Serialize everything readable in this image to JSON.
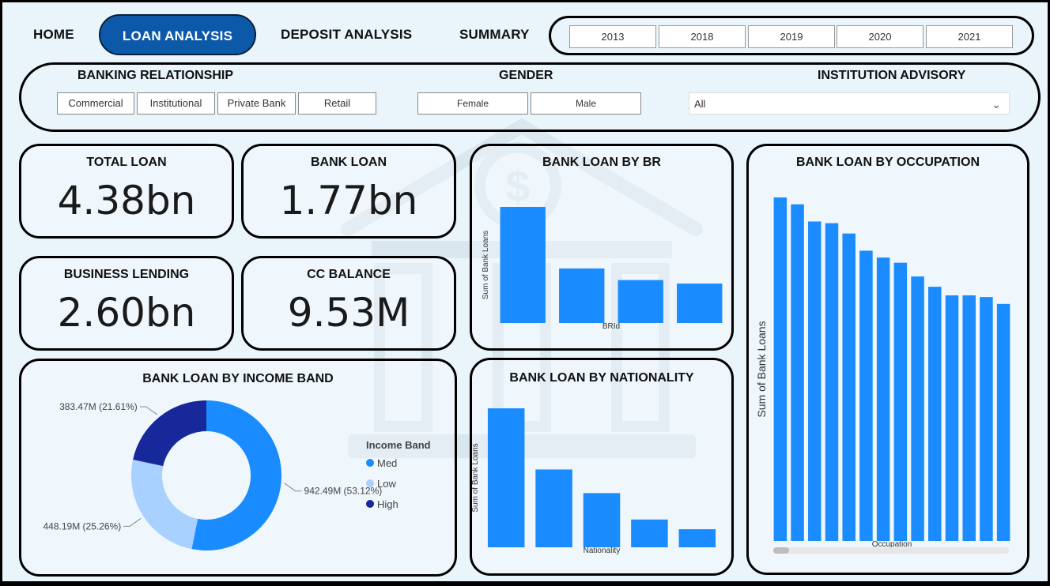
{
  "nav": {
    "home": "HOME",
    "loan_analysis": "LOAN ANALYSIS",
    "deposit_analysis": "DEPOSIT ANALYSIS",
    "summary": "SUMMARY"
  },
  "years": [
    "2013",
    "2018",
    "2019",
    "2020",
    "2021"
  ],
  "filters": {
    "banking_relationship": {
      "title": "BANKING RELATIONSHIP",
      "options": [
        "Commercial",
        "Institutional",
        "Private Bank",
        "Retail"
      ]
    },
    "gender": {
      "title": "GENDER",
      "options": [
        "Female",
        "Male"
      ]
    },
    "institution_advisory": {
      "title": "INSTITUTION ADVISORY",
      "selected": "All"
    }
  },
  "kpis": {
    "total_loan": {
      "label": "TOTAL LOAN",
      "value": "4.38bn"
    },
    "bank_loan": {
      "label": "BANK LOAN",
      "value": "1.77bn"
    },
    "business_lending": {
      "label": "BUSINESS LENDING",
      "value": "2.60bn"
    },
    "cc_balance": {
      "label": "CC BALANCE",
      "value": "9.53M"
    }
  },
  "colors": {
    "accent": "#0c59a9",
    "bar": "#1a8cff",
    "med": "#1a8cff",
    "low": "#a8d1ff",
    "high": "#16289a"
  },
  "chart_data": [
    {
      "id": "by_br",
      "type": "bar",
      "title": "BANK LOAN BY BR",
      "xlabel": "BRId",
      "ylabel": "Sum of Bank Loans",
      "categories": [
        "",
        "",
        "",
        ""
      ],
      "values": [
        100,
        47,
        37,
        34
      ]
    },
    {
      "id": "by_occupation",
      "type": "bar",
      "title": "BANK LOAN BY OCCUPATION",
      "xlabel": "Occupation",
      "ylabel": "Sum of Bank Loans",
      "categories": [
        "",
        "",
        "",
        "",
        "",
        "",
        "",
        "",
        "",
        "",
        "",
        "",
        "",
        ""
      ],
      "values": [
        100,
        98,
        93,
        92.5,
        89.5,
        84.5,
        82.5,
        81,
        77,
        74,
        71.5,
        71.5,
        71,
        69
      ]
    },
    {
      "id": "by_income_band",
      "type": "pie",
      "title": "BANK LOAN BY INCOME BAND",
      "legend_title": "Income Band",
      "slices": [
        {
          "name": "Med",
          "value": 942.49,
          "label": "942.49M (53.12%)"
        },
        {
          "name": "Low",
          "value": 448.19,
          "label": "448.19M (25.26%)"
        },
        {
          "name": "High",
          "value": 383.47,
          "label": "383.47M (21.61%)"
        }
      ]
    },
    {
      "id": "by_nationality",
      "type": "bar",
      "title": "BANK LOAN BY NATIONALITY",
      "xlabel": "Nationality",
      "ylabel": "Sum of Bank Loans",
      "categories": [
        "",
        "",
        "",
        "",
        ""
      ],
      "values": [
        100,
        56,
        39,
        20,
        13
      ]
    }
  ]
}
